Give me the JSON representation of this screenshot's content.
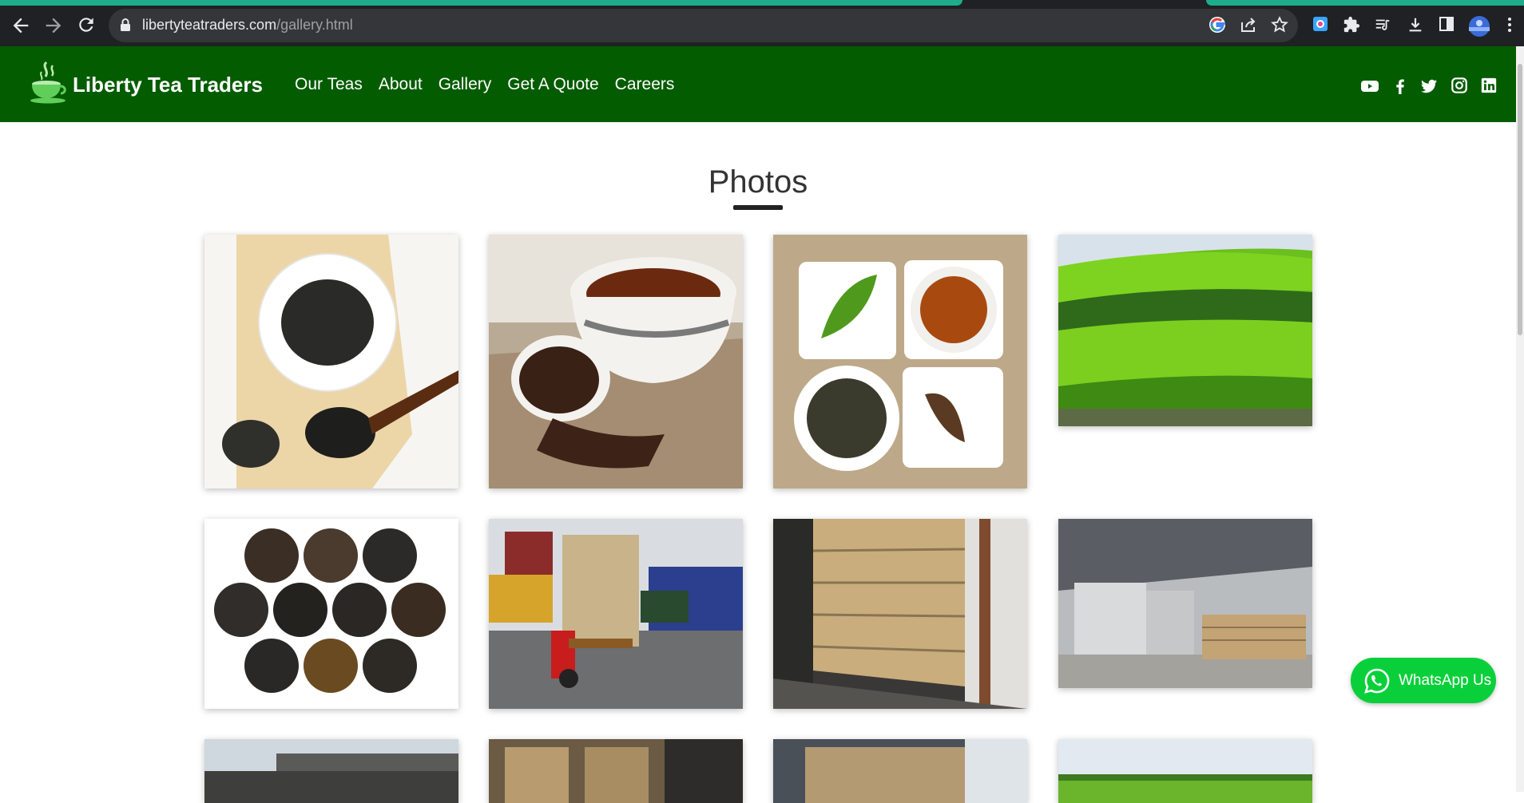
{
  "browser": {
    "url_domain": "libertyteatraders.com",
    "url_path": "/gallery.html",
    "back_icon": "arrow-left-icon",
    "forward_icon": "arrow-right-icon",
    "reload_icon": "reload-icon"
  },
  "header": {
    "brand": "Liberty Tea Traders",
    "nav": [
      "Our Teas",
      "About",
      "Gallery",
      "Get A Quote",
      "Careers"
    ],
    "social_icons": [
      "youtube-icon",
      "facebook-icon",
      "twitter-icon",
      "instagram-icon",
      "linkedin-icon"
    ],
    "bg_color": "#045c00"
  },
  "main": {
    "title": "Photos"
  },
  "whatsapp": {
    "label": "WhatsApp Us",
    "color": "#09d03a"
  }
}
